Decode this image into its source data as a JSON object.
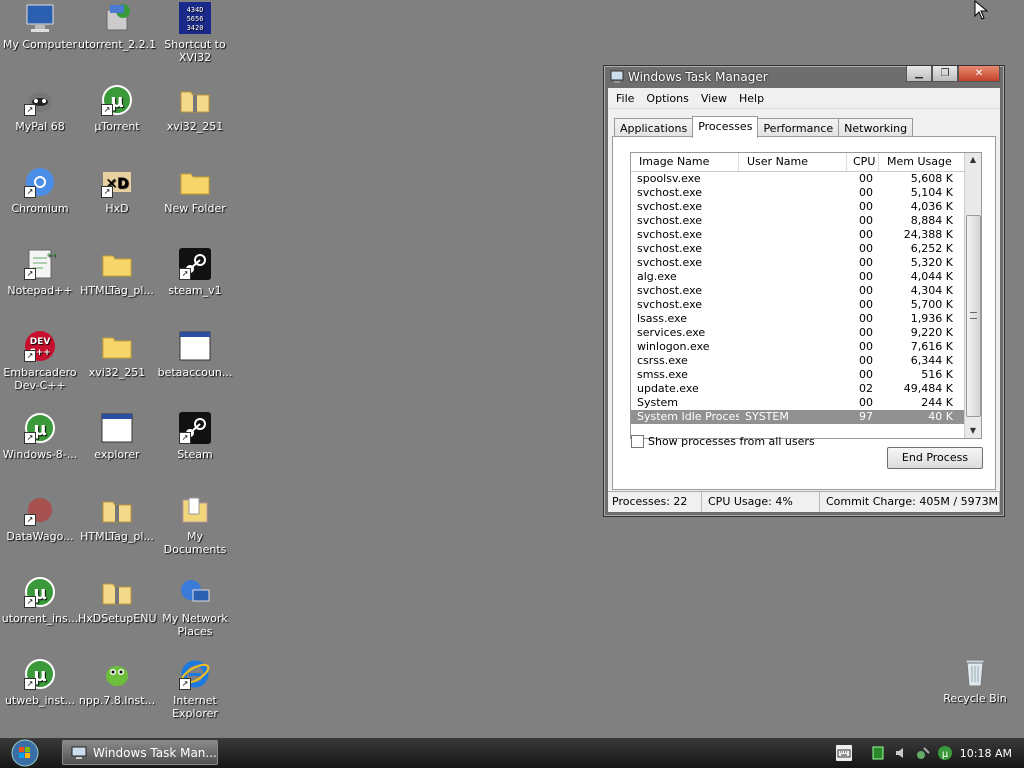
{
  "desktop": {
    "icons": [
      {
        "label": "My Computer"
      },
      {
        "label": "utorrent_2.2.1"
      },
      {
        "label": "Shortcut to XVI32"
      },
      {
        "label": "MyPal 68"
      },
      {
        "label": "µTorrent"
      },
      {
        "label": "xvi32_251"
      },
      {
        "label": "Chromium"
      },
      {
        "label": "HxD"
      },
      {
        "label": "New Folder"
      },
      {
        "label": "Notepad++"
      },
      {
        "label": "HTMLTag_pl..."
      },
      {
        "label": "steam_v1"
      },
      {
        "label": "Embarcadero Dev-C++"
      },
      {
        "label": "xvi32_251"
      },
      {
        "label": "betaaccoun..."
      },
      {
        "label": "Windows-8-..."
      },
      {
        "label": "explorer"
      },
      {
        "label": "Steam"
      },
      {
        "label": "DataWago..."
      },
      {
        "label": "HTMLTag_pl..."
      },
      {
        "label": "My Documents"
      },
      {
        "label": "utorrent_ins..."
      },
      {
        "label": "HxDSetupENU"
      },
      {
        "label": "My Network Places"
      },
      {
        "label": "utweb_inst..."
      },
      {
        "label": "npp.7.8.Inst..."
      },
      {
        "label": "Internet Explorer"
      },
      {
        "label": "Recycle Bin"
      }
    ],
    "icon_texts": {
      "xvi32_glyph": "4 3 4 D\n5 6 5 6\n3 4 2 0",
      "devcpp_glyph": "DEV\nC++"
    }
  },
  "window": {
    "title": "Windows Task Manager",
    "menu": [
      "File",
      "Options",
      "View",
      "Help"
    ],
    "tabs": [
      "Applications",
      "Processes",
      "Performance",
      "Networking"
    ],
    "active_tab": "Processes",
    "columns": [
      "Image Name",
      "User Name",
      "CPU",
      "Mem Usage"
    ],
    "processes": [
      {
        "name": "spoolsv.exe",
        "user": "",
        "cpu": "00",
        "mem": "5,608 K"
      },
      {
        "name": "svchost.exe",
        "user": "",
        "cpu": "00",
        "mem": "5,104 K"
      },
      {
        "name": "svchost.exe",
        "user": "",
        "cpu": "00",
        "mem": "4,036 K"
      },
      {
        "name": "svchost.exe",
        "user": "",
        "cpu": "00",
        "mem": "8,884 K"
      },
      {
        "name": "svchost.exe",
        "user": "",
        "cpu": "00",
        "mem": "24,388 K"
      },
      {
        "name": "svchost.exe",
        "user": "",
        "cpu": "00",
        "mem": "6,252 K"
      },
      {
        "name": "svchost.exe",
        "user": "",
        "cpu": "00",
        "mem": "5,320 K"
      },
      {
        "name": "alg.exe",
        "user": "",
        "cpu": "00",
        "mem": "4,044 K"
      },
      {
        "name": "svchost.exe",
        "user": "",
        "cpu": "00",
        "mem": "4,304 K"
      },
      {
        "name": "svchost.exe",
        "user": "",
        "cpu": "00",
        "mem": "5,700 K"
      },
      {
        "name": "lsass.exe",
        "user": "",
        "cpu": "00",
        "mem": "1,936 K"
      },
      {
        "name": "services.exe",
        "user": "",
        "cpu": "00",
        "mem": "9,220 K"
      },
      {
        "name": "winlogon.exe",
        "user": "",
        "cpu": "00",
        "mem": "7,616 K"
      },
      {
        "name": "csrss.exe",
        "user": "",
        "cpu": "00",
        "mem": "6,344 K"
      },
      {
        "name": "smss.exe",
        "user": "",
        "cpu": "00",
        "mem": "516 K"
      },
      {
        "name": "update.exe",
        "user": "",
        "cpu": "02",
        "mem": "49,484 K"
      },
      {
        "name": "System",
        "user": "",
        "cpu": "00",
        "mem": "244 K"
      },
      {
        "name": "System Idle Process",
        "user": "SYSTEM",
        "cpu": "97",
        "mem": "40 K",
        "selected": true
      }
    ],
    "show_all_label": "Show processes from all users",
    "show_all_checked": false,
    "end_process_label": "End Process",
    "status": {
      "processes": "Processes: 22",
      "cpu": "CPU Usage: 4%",
      "commit": "Commit Charge: 405M / 5973M"
    }
  },
  "taskbar": {
    "task_label": "Windows Task Man...",
    "clock": "10:18 AM"
  },
  "colors": {
    "desktop": "#808080",
    "selected_row": "#919191",
    "taskbar": "#1e1e1e"
  }
}
